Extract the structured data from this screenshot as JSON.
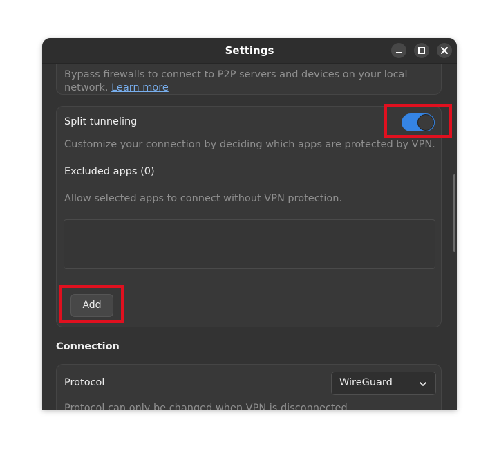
{
  "window": {
    "title": "Settings"
  },
  "lan_card": {
    "description_line1": "Bypass firewalls to connect to P2P servers and devices on your local",
    "description_line2": "network.",
    "learn_more": "Learn more"
  },
  "split_tunneling": {
    "label": "Split tunneling",
    "enabled": true,
    "description": "Customize your connection by deciding which apps are protected by VPN.",
    "excluded_title": "Excluded apps (0)",
    "excluded_description": "Allow selected apps to connect without VPN protection.",
    "add_label": "Add"
  },
  "connection": {
    "section_title": "Connection",
    "protocol_label": "Protocol",
    "protocol_value": "WireGuard",
    "protocol_note": "Protocol can only be changed when VPN is disconnected."
  },
  "colors": {
    "accent": "#3584e4",
    "highlight": "#e0101f",
    "link": "#78aeed"
  }
}
